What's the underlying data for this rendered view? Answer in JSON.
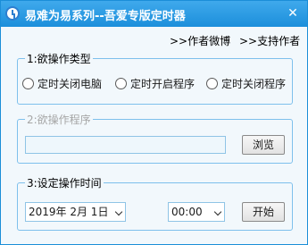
{
  "window": {
    "title": "易难为易系列--吾爱专版定时器",
    "close_glyph": "✕",
    "title_color": "#1c8fdb"
  },
  "top_links": {
    "author_weibo": ">>作者微博",
    "support_author": ">>支持作者"
  },
  "group1": {
    "title": "1:欲操作类型",
    "options": [
      "定时关闭电脑",
      "定时开启程序",
      "定时关闭程序"
    ]
  },
  "group2": {
    "title": "2:欲操作程序",
    "program_value": "",
    "browse_label": "浏览"
  },
  "group3": {
    "title": "3:设定操作时间",
    "date_value": "2019年  2月  1日",
    "time_value": "00:00",
    "start_label": "开始"
  }
}
